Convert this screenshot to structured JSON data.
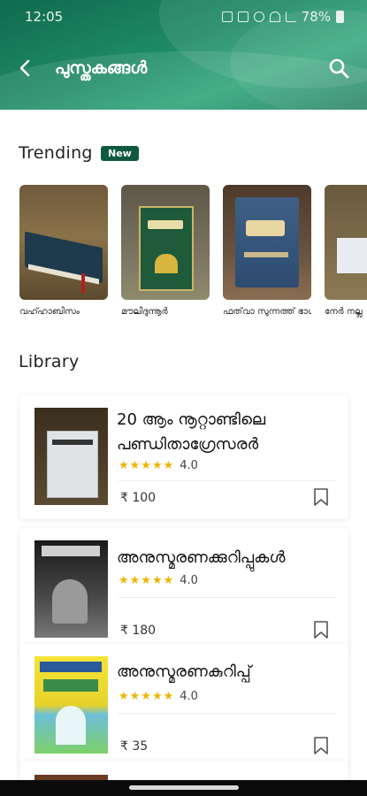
{
  "status_bar": {
    "time": "12:05",
    "battery": "78%"
  },
  "header": {
    "title": "പുസ്തകങ്ങൾ",
    "back_icon": "arrow-left-icon",
    "search_icon": "search-icon"
  },
  "trending": {
    "title": "Trending",
    "badge": "New",
    "items": [
      {
        "name": "വഹ്ഹാബിസം"
      },
      {
        "name": "മൗലിദുന്നൂർ"
      },
      {
        "name": "ഫത്‌വാ സുന്നത്ത് ഭാഗം |"
      },
      {
        "name": "നേർ നല്ല"
      }
    ]
  },
  "library": {
    "title": "Library",
    "books": [
      {
        "name": "20 ആം നൂറ്റാണ്ടിലെ പണ്ഡിതാഗ്രേസരർ",
        "rating": "4.0",
        "stars": 5,
        "price": "₹ 100"
      },
      {
        "name": "അനുസ്മരണക്കുറിപ്പുകൾ",
        "rating": "4.0",
        "stars": 5,
        "price": "₹ 180"
      },
      {
        "name": "അനുസ്മരണകുറിപ്പ്",
        "rating": "4.0",
        "stars": 5,
        "price": "₹ 35"
      }
    ]
  },
  "colors": {
    "header": "#1f8a66",
    "badge": "#0f5a3f",
    "star": "#f0b400"
  }
}
